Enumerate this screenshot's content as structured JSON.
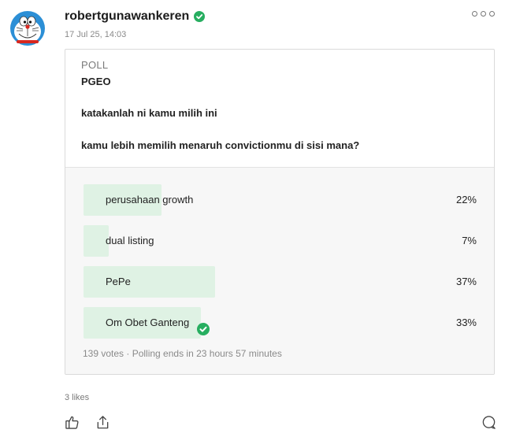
{
  "post": {
    "username": "robertgunawankeren",
    "timestamp": "17 Jul 25, 14:03",
    "likes": "3 likes"
  },
  "poll": {
    "label": "POLL",
    "title": "PGEO",
    "text": "katakanlah ni kamu milih ini",
    "question": "kamu lebih memilih menaruh convictionmu di sisi mana?",
    "options": [
      {
        "label": "perusahaan growth",
        "percent_text": "22%",
        "percent": 22,
        "selected": false
      },
      {
        "label": "dual listing",
        "percent_text": "7%",
        "percent": 7,
        "selected": false
      },
      {
        "label": "PePe",
        "percent_text": "37%",
        "percent": 37,
        "selected": false
      },
      {
        "label": "Om Obet Ganteng",
        "percent_text": "33%",
        "percent": 33,
        "selected": true
      }
    ],
    "footer": "139 votes · Polling ends in 23 hours 57 minutes"
  },
  "colors": {
    "accent": "#27ae60",
    "bar": "#dff2e4"
  },
  "icons": {
    "avatar": "doraemon-avatar",
    "verified": "verified-check-icon",
    "more": "more-options-icon",
    "like": "thumbs-up-icon",
    "share": "share-icon",
    "comment": "comment-icon"
  }
}
